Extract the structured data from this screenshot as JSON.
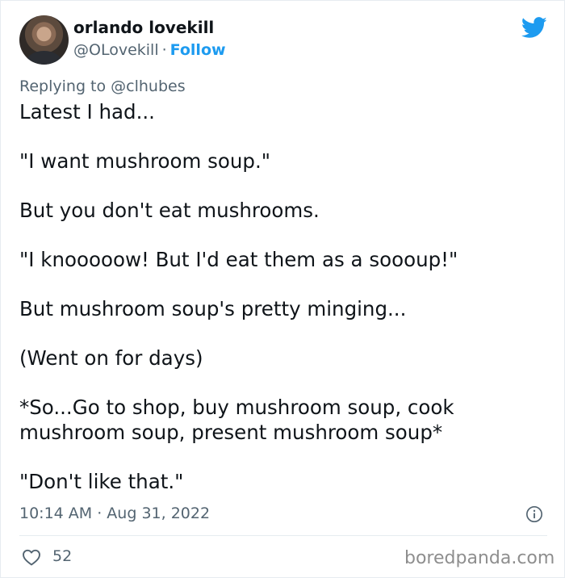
{
  "author": {
    "name": "orlando lovekill",
    "handle": "@OLovekill",
    "separator": "·",
    "follow_label": "Follow"
  },
  "reply_to": "Replying to @clhubes",
  "paragraphs": [
    "Latest I had...",
    "\"I want mushroom soup.\"",
    "But you don't eat mushrooms.",
    "\"I knooooow! But I'd eat them as a soooup!\"",
    "But mushroom soup's pretty minging...",
    "(Went on for days)",
    "*So...Go to shop, buy mushroom soup, cook mushroom soup, present mushroom soup*",
    "\"Don't like that.\""
  ],
  "timestamp": "10:14 AM · Aug 31, 2022",
  "likes": "52",
  "watermark": "boredpanda.com",
  "icons": {
    "brand": "twitter-bird-icon",
    "info": "info-icon",
    "like": "heart-icon"
  },
  "colors": {
    "accent": "#1d9bf0",
    "text": "#0f1419",
    "muted": "#536471"
  }
}
